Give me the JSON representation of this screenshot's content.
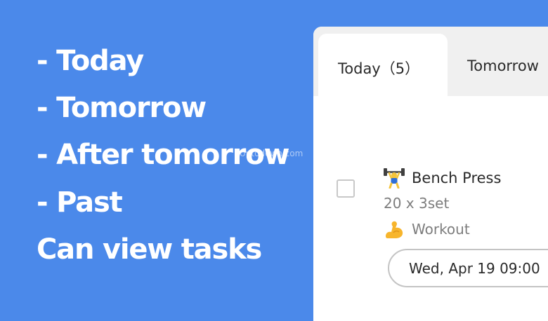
{
  "promo": {
    "lines": [
      "- Today",
      "- Tomorrow",
      "- After tomorrow",
      "- Past",
      "Can view tasks"
    ],
    "watermark": "Uptodown.com"
  },
  "app": {
    "tabs": [
      {
        "label": "Today（5）",
        "active": true
      },
      {
        "label": "Tomorrow",
        "active": false
      }
    ],
    "task": {
      "icon": "weightlifter-emoji-icon",
      "title": "Bench Press",
      "sets": "20 x 3set",
      "category_icon": "flexed-biceps-emoji-icon",
      "category": "Workout",
      "date": "Wed, Apr 19 09:00",
      "checked": false
    }
  },
  "colors": {
    "background": "#4b89ea",
    "text_primary": "#2a2a2a",
    "text_secondary": "#7d7d7d",
    "tab_bar": "#f0f0f0"
  }
}
